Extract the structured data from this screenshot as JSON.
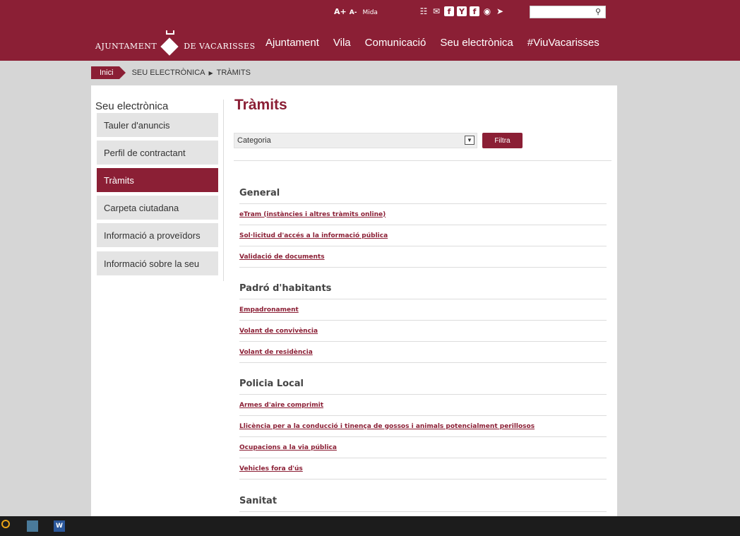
{
  "topbar": {
    "font_larger": "A+",
    "font_smaller": "A-",
    "font_label": "Mida",
    "social_icons": [
      "sitemap-icon",
      "mail-icon",
      "facebook-icon",
      "youtube-icon",
      "flickr-icon",
      "instagram-icon",
      "telegram-icon"
    ],
    "search_placeholder": ""
  },
  "header": {
    "logo_left": "AJUNTAMENT",
    "logo_right": "DE VACARISSES",
    "nav": [
      "Ajuntament",
      "Vila",
      "Comunicació",
      "Seu electrònica",
      "#ViuVacarisses"
    ]
  },
  "breadcrumb": {
    "home": "Inici",
    "items": [
      "SEU ELECTRÒNICA",
      "TRÀMITS"
    ]
  },
  "sidebar": {
    "title": "Seu electrònica",
    "items": [
      {
        "label": "Tauler d'anuncis",
        "active": false
      },
      {
        "label": "Perfil de contractant",
        "active": false
      },
      {
        "label": "Tràmits",
        "active": true
      },
      {
        "label": "Carpeta ciutadana",
        "active": false
      },
      {
        "label": "Informació a proveïdors",
        "active": false
      },
      {
        "label": "Informació sobre la seu",
        "active": false
      }
    ]
  },
  "main": {
    "title": "Tràmits",
    "filter_select": "Categoria",
    "filter_button": "Filtra",
    "sections": [
      {
        "heading": "General",
        "links": [
          "eTram (instàncies i altres tràmits online)",
          "Sol·licitud d'accés a la informació pública",
          "Validació de documents"
        ]
      },
      {
        "heading": "Padró d'habitants",
        "links": [
          "Empadronament",
          "Volant de convivència",
          "Volant de residència"
        ]
      },
      {
        "heading": "Policia Local",
        "links": [
          "Armes d'aire comprimit",
          "Llicència per a la conducció i tinença de gossos i animals potencialment perillosos",
          "Ocupacions a la via pública",
          "Vehicles fora d'ús"
        ]
      },
      {
        "heading": "Sanitat",
        "links": []
      }
    ]
  },
  "colors": {
    "brand": "#8b1f35",
    "background": "#d6d6d6"
  }
}
